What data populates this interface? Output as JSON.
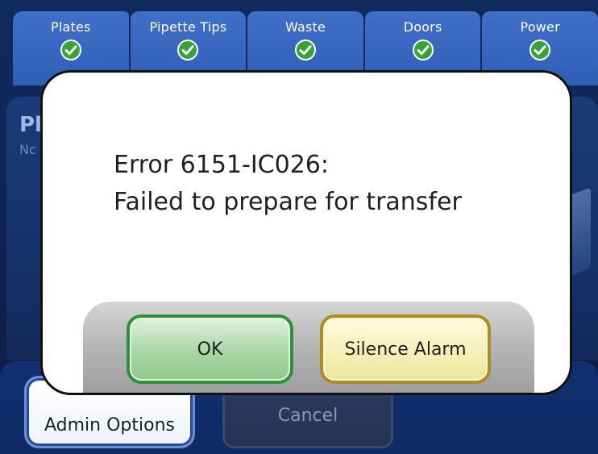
{
  "status_tabs": [
    {
      "label": "Plates",
      "state": "ok"
    },
    {
      "label": "Pipette Tips",
      "state": "ok"
    },
    {
      "label": "Waste",
      "state": "ok"
    },
    {
      "label": "Doors",
      "state": "ok"
    },
    {
      "label": "Power",
      "state": "ok"
    }
  ],
  "background": {
    "title_partial": "Pl",
    "subtitle_partial": "Nc"
  },
  "bottom_bar": {
    "admin_label": "Admin Options",
    "cancel_label": "Cancel"
  },
  "dialog": {
    "line1": "Error 6151-IC026:",
    "line2": "Failed to prepare for transfer",
    "ok_label": "OK",
    "silence_label": "Silence Alarm"
  },
  "colors": {
    "status_tab": "#3f6fc7",
    "check_green": "#2e9b2f",
    "ok_border": "#2f8f3c",
    "silence_border": "#b08a24"
  }
}
